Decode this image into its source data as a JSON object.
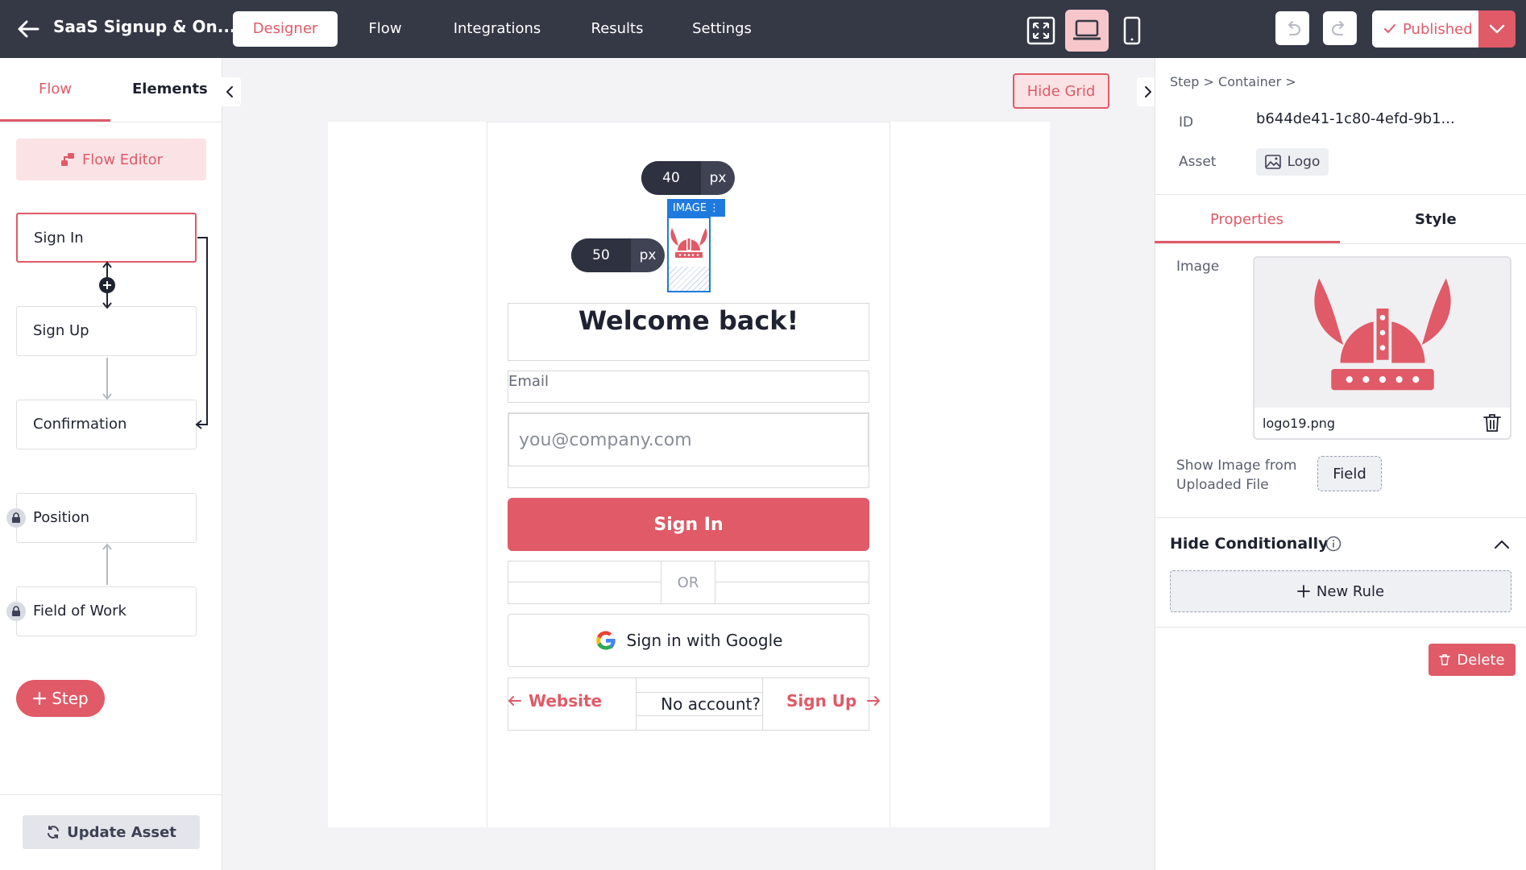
{
  "header": {
    "title": "SaaS Signup & On...",
    "tabs": [
      {
        "label": "Designer",
        "active": true
      },
      {
        "label": "Flow"
      },
      {
        "label": "Integrations"
      },
      {
        "label": "Results"
      },
      {
        "label": "Settings"
      }
    ],
    "view_modes": [
      "fullscreen-icon",
      "desktop-icon",
      "mobile-icon"
    ],
    "active_view": "desktop",
    "publish_label": "Published"
  },
  "left_panel": {
    "tabs": [
      {
        "label": "Flow",
        "active": true
      },
      {
        "label": "Elements"
      }
    ],
    "flow_editor_label": "Flow Editor",
    "steps": [
      {
        "label": "Sign In",
        "selected": true
      },
      {
        "label": "Sign Up"
      },
      {
        "label": "Confirmation"
      },
      {
        "label": "Position",
        "locked": true
      },
      {
        "label": "Field of Work",
        "locked": true
      }
    ],
    "add_step_label": "Step",
    "update_asset_label": "Update Asset"
  },
  "canvas": {
    "hide_grid_label": "Hide Grid",
    "height_value": "40",
    "width_value": "50",
    "unit": "px",
    "image_tag": "IMAGE",
    "heading": "Welcome back!",
    "email_label": "Email",
    "email_placeholder": "you@company.com",
    "signin_label": "Sign In",
    "or_label": "OR",
    "google_label": "Sign in with Google",
    "website_label": "Website",
    "no_account_label": "No account?",
    "signup_label": "Sign Up"
  },
  "right_panel": {
    "breadcrumb": [
      "Step",
      "Container"
    ],
    "id_label": "ID",
    "id_value": "b644de41-1c80-4efd-9b1...",
    "asset_label": "Asset",
    "asset_value": "Logo",
    "tabs": [
      {
        "label": "Properties",
        "active": true
      },
      {
        "label": "Style"
      }
    ],
    "image_label": "Image",
    "image_filename": "logo19.png",
    "show_image_label_1": "Show Image from",
    "show_image_label_2": "Uploaded File",
    "field_label": "Field",
    "hide_conditionally_label": "Hide Conditionally",
    "new_rule_label": "New Rule",
    "delete_label": "Delete"
  },
  "colors": {
    "accent": "#e05a67",
    "topbar": "#353845",
    "selection": "#1f7ae0"
  }
}
